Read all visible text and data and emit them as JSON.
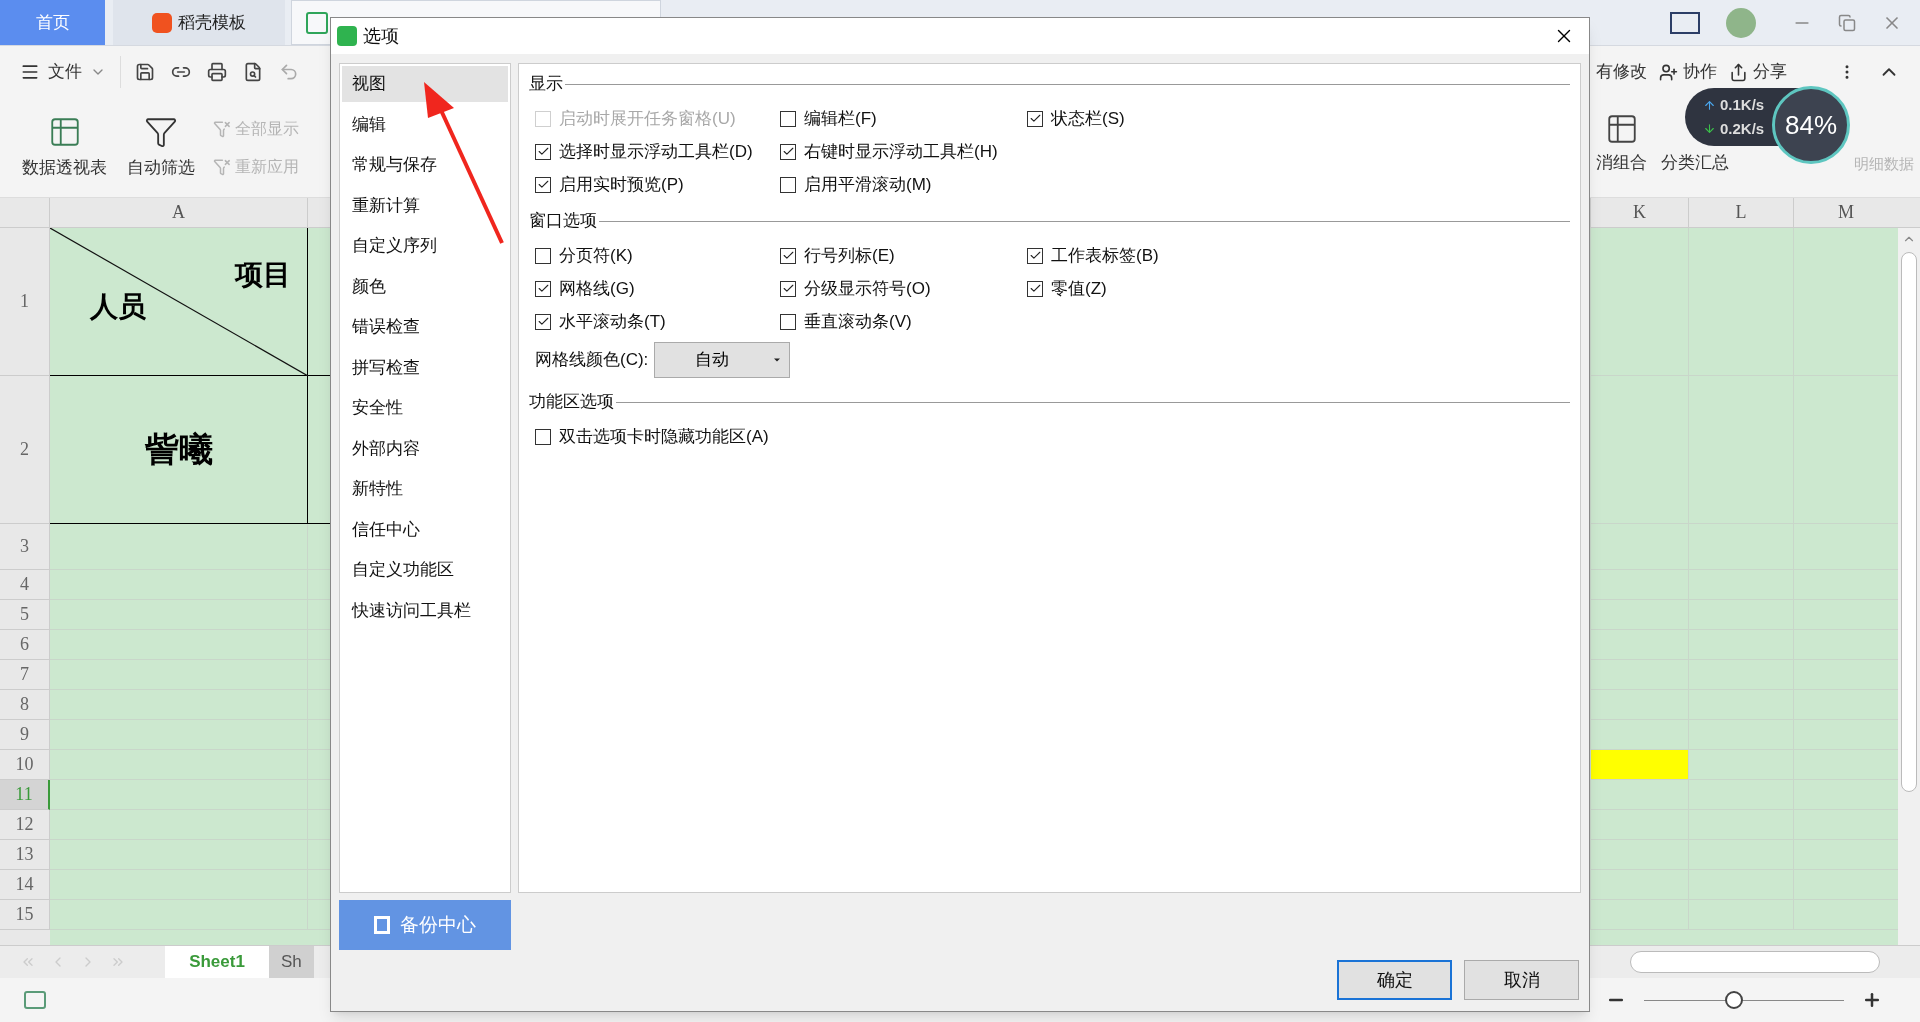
{
  "app": {
    "tabs": [
      {
        "label": "首页",
        "kind": "home"
      },
      {
        "label": "稻壳模板",
        "kind": "template"
      }
    ],
    "file_menu": "文件",
    "status_actions": [
      "有修改",
      "协作",
      "分享"
    ],
    "ribbon_left": [
      {
        "label": "数据透视表",
        "kind": "pivot"
      },
      {
        "label": "自动筛选",
        "kind": "filter"
      }
    ],
    "ribbon_small": [
      {
        "label": "全部显示",
        "disabled": true
      },
      {
        "label": "重新应用",
        "disabled": true
      }
    ],
    "ribbon_right": [
      {
        "label": "消组合",
        "kind": "ungroup",
        "disabled": false
      },
      {
        "label": "分类汇总",
        "kind": "subtotal",
        "disabled": false
      },
      {
        "label": "明细数据",
        "kind": "detail",
        "disabled": true
      }
    ],
    "network_widget": {
      "upload": "0.1K/s",
      "download": "0.2K/s",
      "percent": "84%"
    },
    "zoom_slider": {
      "level": 0.45
    }
  },
  "sheet": {
    "left_columns": [
      "A"
    ],
    "right_columns": [
      "K",
      "L",
      "M"
    ],
    "header_cell": {
      "top_right": "项目",
      "bottom_left": "人员"
    },
    "name_cell": "訾曦",
    "rows": [
      {
        "label": "1",
        "selected": false,
        "marked": false
      },
      {
        "label": "2",
        "selected": false,
        "marked": false
      },
      {
        "label": "3",
        "selected": false,
        "marked": false
      },
      {
        "label": "4",
        "selected": false,
        "marked": false
      },
      {
        "label": "5",
        "selected": false,
        "marked": false
      },
      {
        "label": "6",
        "selected": false,
        "marked": false
      },
      {
        "label": "7",
        "selected": false,
        "marked": false
      },
      {
        "label": "8",
        "selected": false,
        "marked": false
      },
      {
        "label": "9",
        "selected": false,
        "marked": false
      },
      {
        "label": "10",
        "selected": false,
        "marked": true
      },
      {
        "label": "11",
        "selected": true,
        "marked": false
      },
      {
        "label": "12",
        "selected": false,
        "marked": false
      },
      {
        "label": "13",
        "selected": false,
        "marked": false
      },
      {
        "label": "14",
        "selected": false,
        "marked": false
      },
      {
        "label": "15",
        "selected": false,
        "marked": false
      }
    ],
    "sheet_tabs": [
      {
        "label": "Sheet1",
        "selected": true
      },
      {
        "label": "Sh",
        "selected": false
      }
    ]
  },
  "dialog": {
    "title": "选项",
    "nav": [
      {
        "label": "视图",
        "selected": true
      },
      {
        "label": "编辑",
        "selected": false
      },
      {
        "label": "常规与保存",
        "selected": false
      },
      {
        "label": "重新计算",
        "selected": false
      },
      {
        "label": "自定义序列",
        "selected": false
      },
      {
        "label": "颜色",
        "selected": false
      },
      {
        "label": "错误检查",
        "selected": false
      },
      {
        "label": "拼写检查",
        "selected": false
      },
      {
        "label": "安全性",
        "selected": false
      },
      {
        "label": "外部内容",
        "selected": false
      },
      {
        "label": "新特性",
        "selected": false
      },
      {
        "label": "信任中心",
        "selected": false
      },
      {
        "label": "自定义功能区",
        "selected": false
      },
      {
        "label": "快速访问工具栏",
        "selected": false
      }
    ],
    "sections": [
      {
        "title": "显示",
        "rows": [
          [
            {
              "label": "启动时展开任务窗格(U)",
              "checked": false,
              "disabled": true
            },
            {
              "label": "编辑栏(F)",
              "checked": false,
              "disabled": false
            },
            {
              "label": "状态栏(S)",
              "checked": true,
              "disabled": false
            }
          ],
          [
            {
              "label": "选择时显示浮动工具栏(D)",
              "checked": true,
              "disabled": false
            },
            {
              "label": "右键时显示浮动工具栏(H)",
              "checked": true,
              "disabled": false
            }
          ],
          [
            {
              "label": "启用实时预览(P)",
              "checked": true,
              "disabled": false
            },
            {
              "label": "启用平滑滚动(M)",
              "checked": false,
              "disabled": false
            }
          ]
        ]
      },
      {
        "title": "窗口选项",
        "rows": [
          [
            {
              "label": "分页符(K)",
              "checked": false,
              "disabled": false
            },
            {
              "label": "行号列标(E)",
              "checked": true,
              "disabled": false
            },
            {
              "label": "工作表标签(B)",
              "checked": true,
              "disabled": false
            }
          ],
          [
            {
              "label": "网格线(G)",
              "checked": true,
              "disabled": false
            },
            {
              "label": "分级显示符号(O)",
              "checked": true,
              "disabled": false
            },
            {
              "label": "零值(Z)",
              "checked": true,
              "disabled": false
            }
          ],
          [
            {
              "label": "水平滚动条(T)",
              "checked": true,
              "disabled": false
            },
            {
              "label": "垂直滚动条(V)",
              "checked": false,
              "disabled": false
            }
          ]
        ],
        "dropdown": {
          "label": "网格线颜色(C):",
          "value": "自动"
        }
      },
      {
        "title": "功能区选项",
        "rows": [
          [
            {
              "label": "双击选项卡时隐藏功能区(A)",
              "checked": false,
              "disabled": false
            }
          ]
        ]
      }
    ],
    "backup_button": "备份中心",
    "buttons": [
      {
        "label": "确定",
        "default": true
      },
      {
        "label": "取消",
        "default": false
      }
    ]
  }
}
